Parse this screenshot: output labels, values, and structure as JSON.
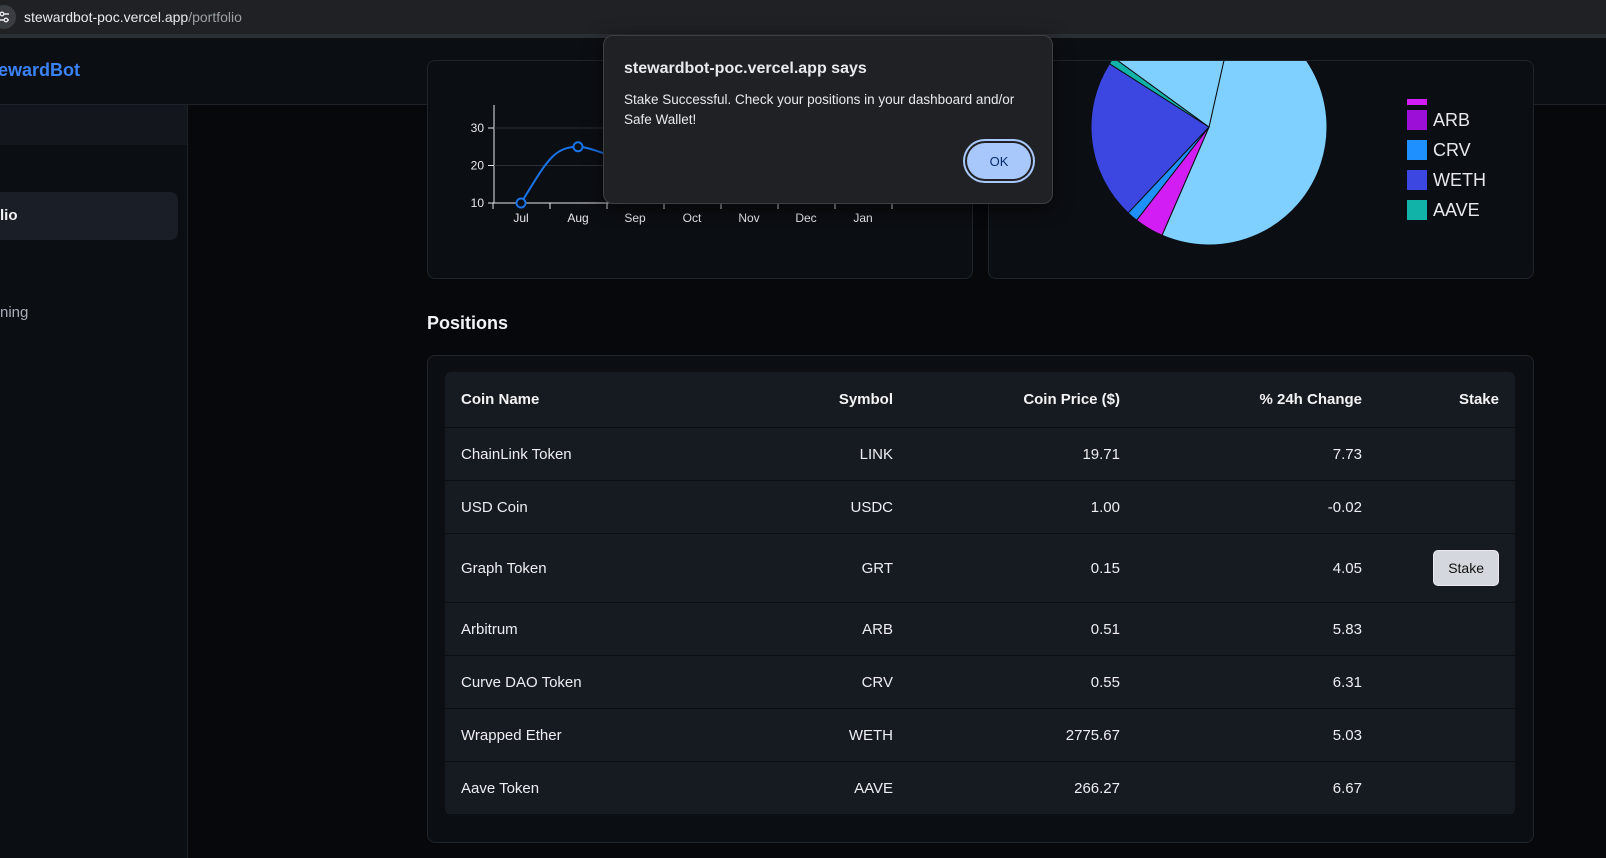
{
  "browser": {
    "url_host": "stewardbot-poc.vercel.app",
    "url_path": "/portfolio"
  },
  "header": {
    "brand": "ewardBot"
  },
  "sidebar": {
    "active_item": "lio",
    "other_item": "ning"
  },
  "chart_data": [
    {
      "type": "line",
      "categories": [
        "Jul",
        "Aug",
        "Sep",
        "Oct",
        "Nov",
        "Dec",
        "Jan"
      ],
      "yticks": [
        10,
        20,
        30
      ],
      "ylim_visible": [
        10,
        33
      ],
      "series": [
        {
          "values": [
            10,
            25,
            20
          ]
        }
      ],
      "color": "#1a73e8"
    },
    {
      "type": "pie",
      "legend": [
        {
          "label": "ARB",
          "color": "#9b0fd6"
        },
        {
          "label": "CRV",
          "color": "#1e90ff"
        },
        {
          "label": "WETH",
          "color": "#3b47e0"
        },
        {
          "label": "AAVE",
          "color": "#11b3a8"
        }
      ],
      "slices_visible": [
        {
          "color": "#7fd0ff",
          "value": 0.53
        },
        {
          "color": "#d21ef5",
          "value": 0.04
        },
        {
          "color": "#1e90ff",
          "value": 0.015
        },
        {
          "color": "#3b47e0",
          "value": 0.22
        },
        {
          "color": "#11b3a8",
          "value": 0.01
        }
      ]
    }
  ],
  "positions": {
    "title": "Positions",
    "columns": [
      "Coin Name",
      "Symbol",
      "Coin Price ($)",
      "% 24h Change",
      "Stake"
    ],
    "rows": [
      {
        "name": "ChainLink Token",
        "symbol": "LINK",
        "price": "19.71",
        "change": "7.73",
        "stake": ""
      },
      {
        "name": "USD Coin",
        "symbol": "USDC",
        "price": "1.00",
        "change": "-0.02",
        "stake": ""
      },
      {
        "name": "Graph Token",
        "symbol": "GRT",
        "price": "0.15",
        "change": "4.05",
        "stake": "Stake"
      },
      {
        "name": "Arbitrum",
        "symbol": "ARB",
        "price": "0.51",
        "change": "5.83",
        "stake": ""
      },
      {
        "name": "Curve DAO Token",
        "symbol": "CRV",
        "price": "0.55",
        "change": "6.31",
        "stake": ""
      },
      {
        "name": "Wrapped Ether",
        "symbol": "WETH",
        "price": "2775.67",
        "change": "5.03",
        "stake": ""
      },
      {
        "name": "Aave Token",
        "symbol": "AAVE",
        "price": "266.27",
        "change": "6.67",
        "stake": ""
      }
    ]
  },
  "dialog": {
    "title": "stewardbot-poc.vercel.app says",
    "message": "Stake Successful. Check your positions in your dashboard and/or Safe Wallet!",
    "ok_label": "OK"
  }
}
